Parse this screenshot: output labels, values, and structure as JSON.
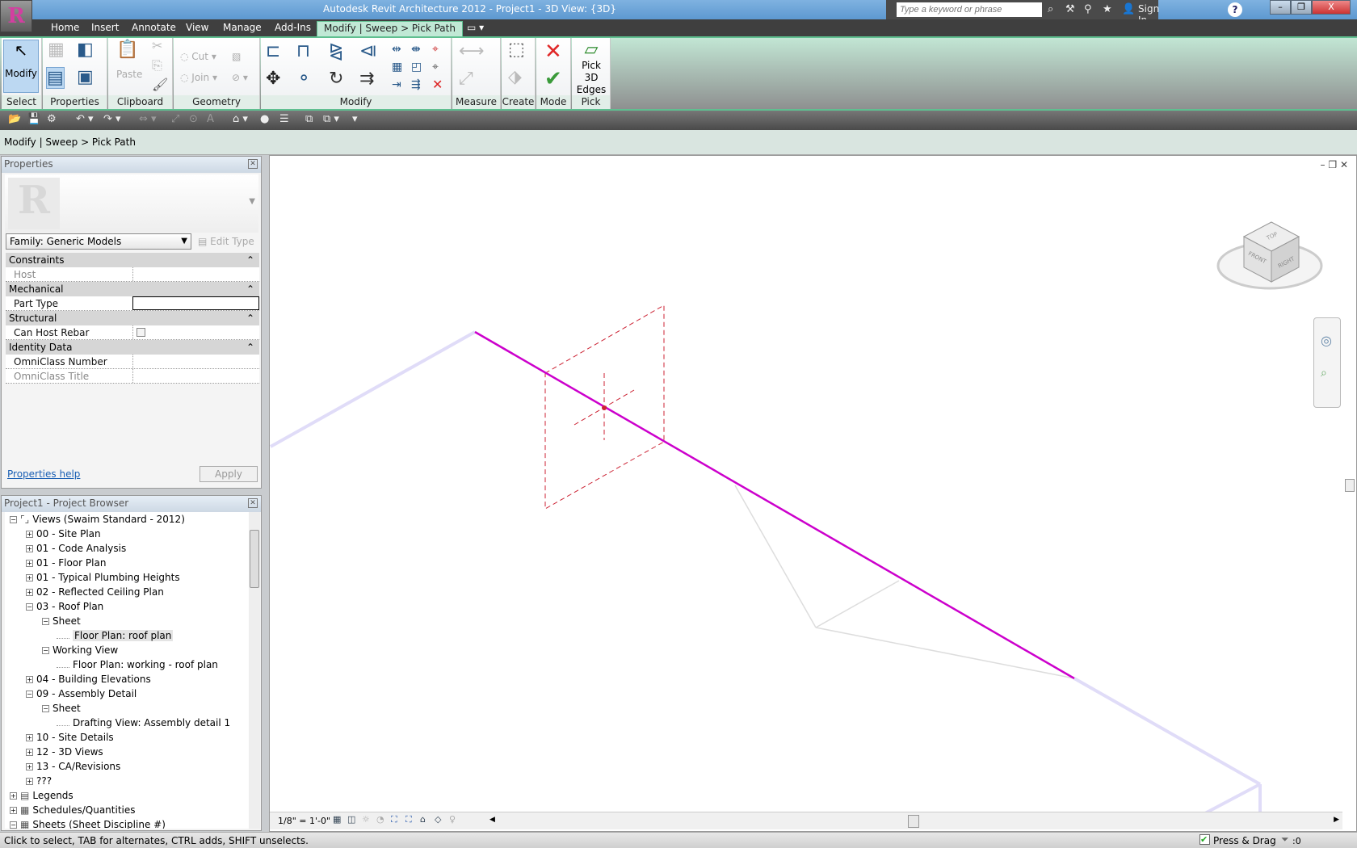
{
  "app": {
    "title": "Autodesk Revit Architecture 2012 -     Project1 - 3D View: {3D}",
    "logo_letter": "R"
  },
  "search": {
    "placeholder": "Type a keyword or phrase",
    "sign_in": "Sign In"
  },
  "tabs": [
    {
      "label": "Home"
    },
    {
      "label": "Insert"
    },
    {
      "label": "Annotate"
    },
    {
      "label": "View"
    },
    {
      "label": "Manage"
    },
    {
      "label": "Add-Ins"
    },
    {
      "label": "Modify | Sweep > Pick Path",
      "active": true
    }
  ],
  "ribbon": {
    "panels": [
      {
        "label": "Select"
      },
      {
        "label": "Properties"
      },
      {
        "label": "Clipboard"
      },
      {
        "label": "Geometry"
      },
      {
        "label": "Modify"
      },
      {
        "label": "Measure"
      },
      {
        "label": "Create"
      },
      {
        "label": "Mode"
      },
      {
        "label": "Pick"
      }
    ],
    "modify_label": "Modify",
    "paste_label": "Paste",
    "cut_label": "Cut",
    "join_label": "Join",
    "pick3d_label": "Pick 3D Edges"
  },
  "options_bar": {
    "text": "Modify | Sweep > Pick Path"
  },
  "properties": {
    "title": "Properties",
    "family": "Family: Generic Models",
    "edit_type": "Edit Type",
    "help": "Properties help",
    "apply": "Apply",
    "rows": [
      {
        "type": "cat",
        "label": "Constraints"
      },
      {
        "type": "param",
        "label": "Host",
        "dim": true
      },
      {
        "type": "cat",
        "label": "Mechanical"
      },
      {
        "type": "param",
        "label": "Part Type",
        "edit": true
      },
      {
        "type": "cat",
        "label": "Structural"
      },
      {
        "type": "param",
        "label": "Can Host Rebar",
        "check": true
      },
      {
        "type": "cat",
        "label": "Identity Data"
      },
      {
        "type": "param",
        "label": "OmniClass Number"
      },
      {
        "type": "param",
        "label": "OmniClass Title",
        "dim": true
      }
    ]
  },
  "browser": {
    "title": "Project1 - Project Browser",
    "items": [
      {
        "label": "Views (Swaim Standard - 2012)",
        "level": 0,
        "sign": "-"
      },
      {
        "label": "00 - Site Plan",
        "level": 1,
        "sign": "+"
      },
      {
        "label": "01 - Code Analysis",
        "level": 1,
        "sign": "+"
      },
      {
        "label": "01 - Floor Plan",
        "level": 1,
        "sign": "+"
      },
      {
        "label": "01 - Typical Plumbing Heights",
        "level": 1,
        "sign": "+"
      },
      {
        "label": "02 - Reflected Ceiling Plan",
        "level": 1,
        "sign": "+"
      },
      {
        "label": "03 - Roof Plan",
        "level": 1,
        "sign": "-"
      },
      {
        "label": "Sheet",
        "level": 2,
        "sign": "-"
      },
      {
        "label": "Floor Plan: roof plan",
        "level": 3,
        "selected": true
      },
      {
        "label": "Working View",
        "level": 2,
        "sign": "-"
      },
      {
        "label": "Floor Plan: working -  roof plan",
        "level": 3
      },
      {
        "label": "04 - Building Elevations",
        "level": 1,
        "sign": "+"
      },
      {
        "label": "09 - Assembly Detail",
        "level": 1,
        "sign": "-"
      },
      {
        "label": "Sheet",
        "level": 2,
        "sign": "-"
      },
      {
        "label": "Drafting View: Assembly detail 1",
        "level": 3
      },
      {
        "label": "10 - Site Details",
        "level": 1,
        "sign": "+"
      },
      {
        "label": "12 - 3D Views",
        "level": 1,
        "sign": "+"
      },
      {
        "label": "13 - CA/Revisions",
        "level": 1,
        "sign": "+"
      },
      {
        "label": "???",
        "level": 1,
        "sign": "+"
      },
      {
        "label": "Legends",
        "level": 0,
        "sign": "+"
      },
      {
        "label": "Schedules/Quantities",
        "level": 0,
        "sign": "+"
      },
      {
        "label": "Sheets (Sheet Discipline #)",
        "level": 0,
        "sign": "-"
      }
    ]
  },
  "viewcube": {
    "top": "TOP",
    "front": "FRONT",
    "right": "RIGHT"
  },
  "view_bar": {
    "scale": "1/8\" = 1'-0\""
  },
  "status": {
    "text": "Click to select, TAB for alternates, CTRL adds, SHIFT unselects.",
    "press_drag": "Press & Drag",
    "filter_count": ":0"
  },
  "colors": {
    "path": "#cc00cc",
    "path_faded": "#e0dcf8",
    "plane": "#cc2233",
    "ribbon": "#c2e6d4"
  }
}
